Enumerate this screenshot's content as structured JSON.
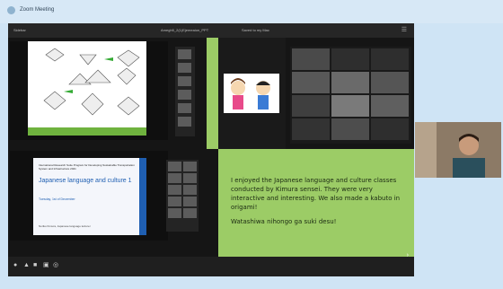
{
  "app": {
    "title": "Zoom Meeting"
  },
  "toolbar": {
    "left_label": "Sidebar",
    "doc_title": "Amegh5_2(1)Ejemeaion_PPT",
    "doc_status": "Saved to my Mac"
  },
  "slide2": {
    "header": "International Research Suite Program for Developing Sustainable Transportation System and Infrastructure 2021",
    "title": "Japanese language and culture 1",
    "date": "Tuesday, 1st of December",
    "footer": "Noriko Kimura, Japanese language lecturer"
  },
  "panel": {
    "paragraph1": "I enjoyed the Japanese language and culture classes conducted by Kimura sensei. They were very interactive and interesting. We also made a kabuto in origami!",
    "paragraph2": "Watashiwa nihongo ga suki desu!"
  },
  "colors": {
    "green": "#9ccc66",
    "blue_slide": "#1f5fb2",
    "window_bg": "#151515"
  },
  "icons": [
    "close-icon",
    "minimize-icon",
    "zoom-icon",
    "menu-icon",
    "next-icon"
  ]
}
